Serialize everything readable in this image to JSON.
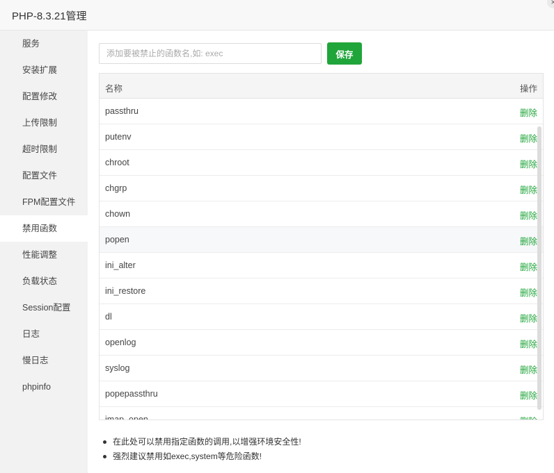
{
  "window": {
    "title": "PHP-8.3.21管理",
    "close_symbol": "×"
  },
  "sidebar": {
    "items": [
      {
        "label": "服务"
      },
      {
        "label": "安装扩展"
      },
      {
        "label": "配置修改"
      },
      {
        "label": "上传限制"
      },
      {
        "label": "超时限制"
      },
      {
        "label": "配置文件"
      },
      {
        "label": "FPM配置文件"
      },
      {
        "label": "禁用函数",
        "active": true
      },
      {
        "label": "性能调整"
      },
      {
        "label": "负载状态"
      },
      {
        "label": "Session配置"
      },
      {
        "label": "日志"
      },
      {
        "label": "慢日志"
      },
      {
        "label": "phpinfo"
      }
    ]
  },
  "toolbar": {
    "input_placeholder": "添加要被禁止的函数名,如: exec",
    "input_value": "",
    "save_label": "保存"
  },
  "table": {
    "headers": {
      "name": "名称",
      "op": "操作"
    },
    "delete_label": "删除",
    "rows": [
      "passthru",
      "putenv",
      "chroot",
      "chgrp",
      "chown",
      "popen",
      "ini_alter",
      "ini_restore",
      "dl",
      "openlog",
      "syslog",
      "popepassthru",
      "imap_open"
    ]
  },
  "tips": [
    "在此处可以禁用指定函数的调用,以增强环境安全性!",
    "强烈建议禁用如exec,system等危险函数!"
  ],
  "colors": {
    "accent": "#20a53a",
    "sidebar_bg": "#f2f2f2"
  }
}
